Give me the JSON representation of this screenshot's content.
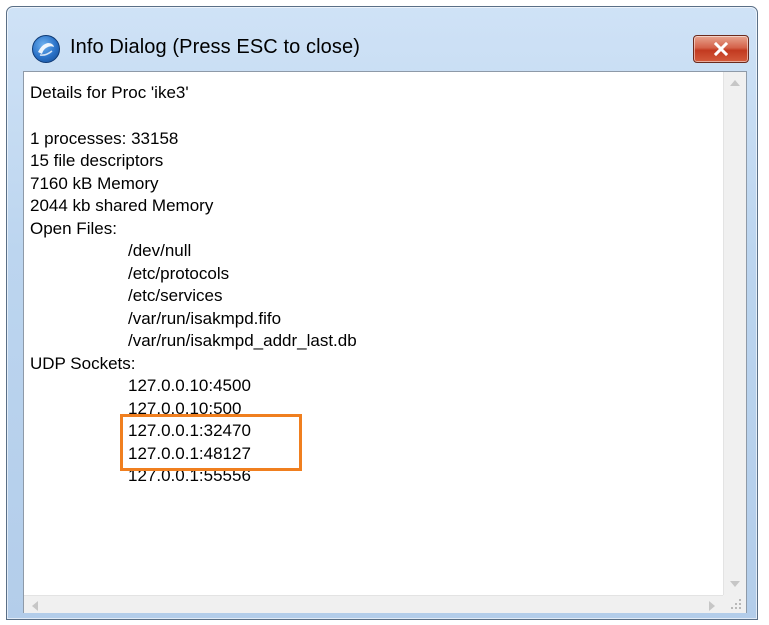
{
  "window": {
    "title": "Info Dialog (Press ESC to close)",
    "title_icon": "app-globe-icon",
    "close_icon": "close-x-icon"
  },
  "content": {
    "heading": "Details for Proc 'ike3'",
    "stats": {
      "processes": "1 processes: 33158",
      "file_descriptors": "15 file descriptors",
      "memory": "7160 kB Memory",
      "shared_memory": "2044 kb shared Memory"
    },
    "open_files_label": "Open Files:",
    "open_files": [
      "/dev/null",
      "/etc/protocols",
      "/etc/services",
      "/var/run/isakmpd.fifo",
      "/var/run/isakmpd_addr_last.db"
    ],
    "udp_sockets_label": "UDP Sockets:",
    "udp_sockets": [
      "127.0.0.10:4500",
      "127.0.0.10:500",
      "127.0.0.1:32470",
      "127.0.0.1:48127",
      "127.0.0.1:55556"
    ]
  },
  "colors": {
    "highlight": "#f07f1f",
    "close_button": "#c23a20",
    "titlebar": "#bcd5ef"
  }
}
